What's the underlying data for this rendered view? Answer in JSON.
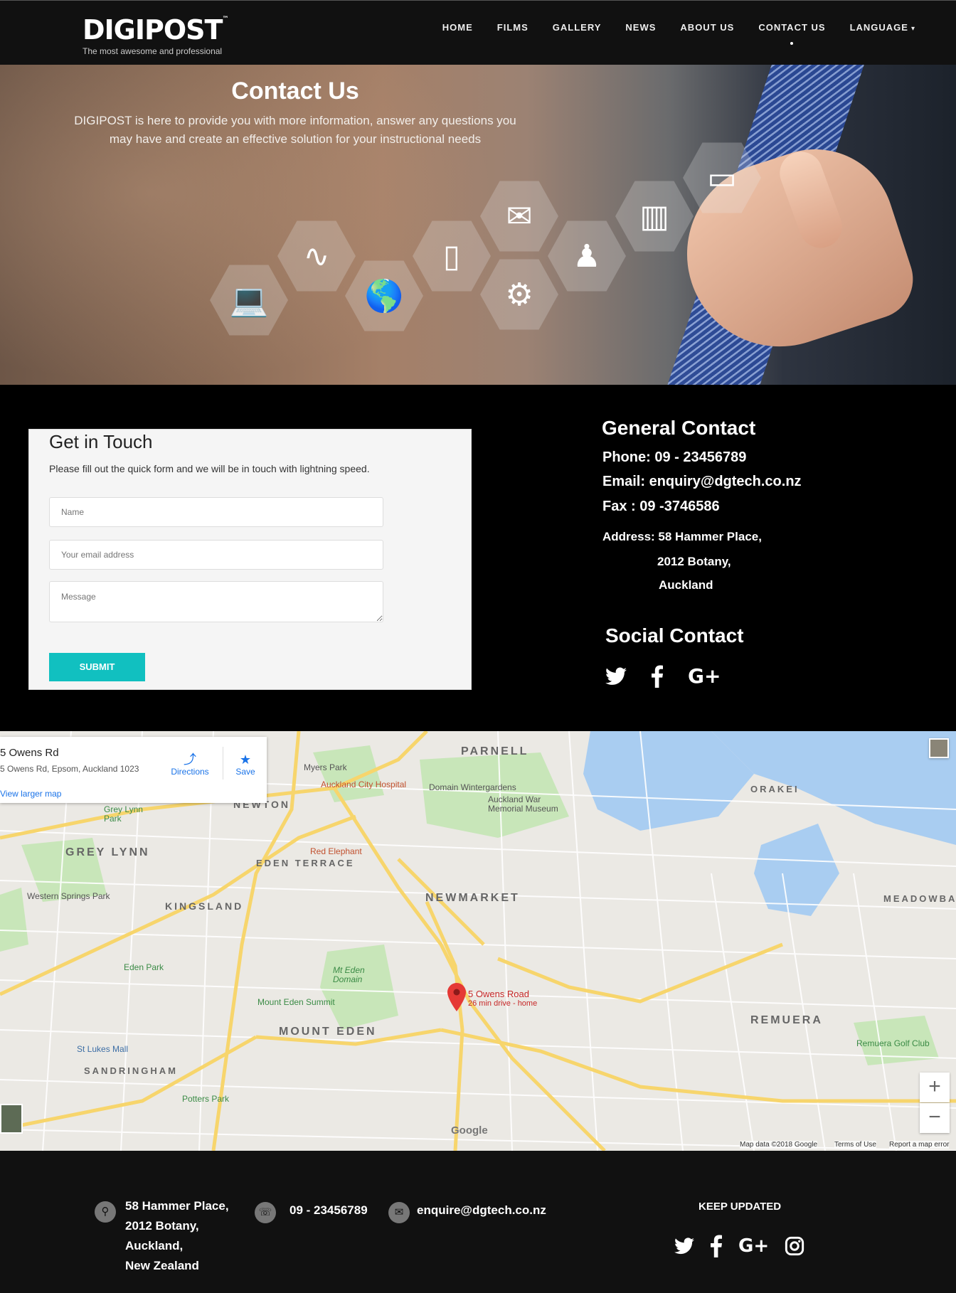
{
  "header": {
    "logo_text": "DIGIPOST",
    "logo_tm": "™",
    "tagline": "The most awesome and professional",
    "nav": [
      "HOME",
      "FILMS",
      "GALLERY",
      "NEWS",
      "ABOUT US",
      "CONTACT US",
      "LANGUAGE"
    ],
    "active": "CONTACT US"
  },
  "hero": {
    "title": "Contact Us",
    "subtitle": "DIGIPOST is here to provide you with more information, answer any questions you may have and create an effective solution for your instructional needs"
  },
  "form": {
    "title": "Get in Touch",
    "description": "Please fill out the quick form and we will be in touch with lightning speed.",
    "name_placeholder": "Name",
    "email_placeholder": "Your email address",
    "message_placeholder": "Message",
    "submit_label": "SUBMIT"
  },
  "general": {
    "title": "General Contact",
    "phone": "Phone: 09 - 23456789",
    "email": "Email:  enquiry@dgtech.co.nz",
    "fax": "Fax : 09 -3746586",
    "address_label": "Address: 58 Hammer Place,",
    "address_2": "2012 Botany,",
    "address_3": "Auckland"
  },
  "social": {
    "title": "Social Contact",
    "icons": [
      "twitter-icon",
      "facebook-icon",
      "google-plus-icon"
    ]
  },
  "map": {
    "place_name": "5 Owens Rd",
    "place_address": "5 Owens Rd, Epsom, Auckland 1023",
    "directions": "Directions",
    "save": "Save",
    "view_larger": "View larger map",
    "marker_label": "5 Owens Road",
    "marker_sub": "26 min drive - home",
    "labels": {
      "parnell": "PARNELL",
      "newton": "NEWTON",
      "grey_lynn": "GREY LYNN",
      "eden_terrace": "EDEN TERRACE",
      "newmarket": "NEWMARKET",
      "kingsland": "KINGSLAND",
      "mount_eden": "MOUNT EDEN",
      "sandringham": "SANDRINGHAM",
      "orakei": "ORAKEI",
      "remuera": "REMUERA",
      "meadowbank": "MEADOWBAN",
      "myers_park": "Myers Park",
      "hospital": "Auckland City Hospital",
      "wintergardens": "Domain Wintergardens",
      "museum": "Auckland War Memorial Museum",
      "red_elephant": "Red Elephant",
      "western_springs": "Western Springs Park",
      "eden_park": "Eden Park",
      "mt_eden_domain": "Mt Eden Domain",
      "mt_eden_summit": "Mount Eden Summit",
      "st_lukes": "St Lukes Mall",
      "potters": "Potters Park",
      "grey_lynn_park": "Grey Lynn Park",
      "remuera_golf": "Remuera Golf Club"
    },
    "attribution": "Map data ©2018 Google",
    "terms": "Terms of Use",
    "report": "Report a map error",
    "google": "Google"
  },
  "footer": {
    "addr_1": "58 Hammer Place,",
    "addr_2": "2012 Botany,",
    "addr_3": "Auckland,",
    "addr_4": "New Zealand",
    "phone": "09 - 23456789",
    "email": "enquire@dgtech.co.nz",
    "keep_updated": "KEEP UPDATED",
    "icons": [
      "twitter-icon",
      "facebook-icon",
      "google-plus-icon",
      "instagram-icon"
    ]
  }
}
